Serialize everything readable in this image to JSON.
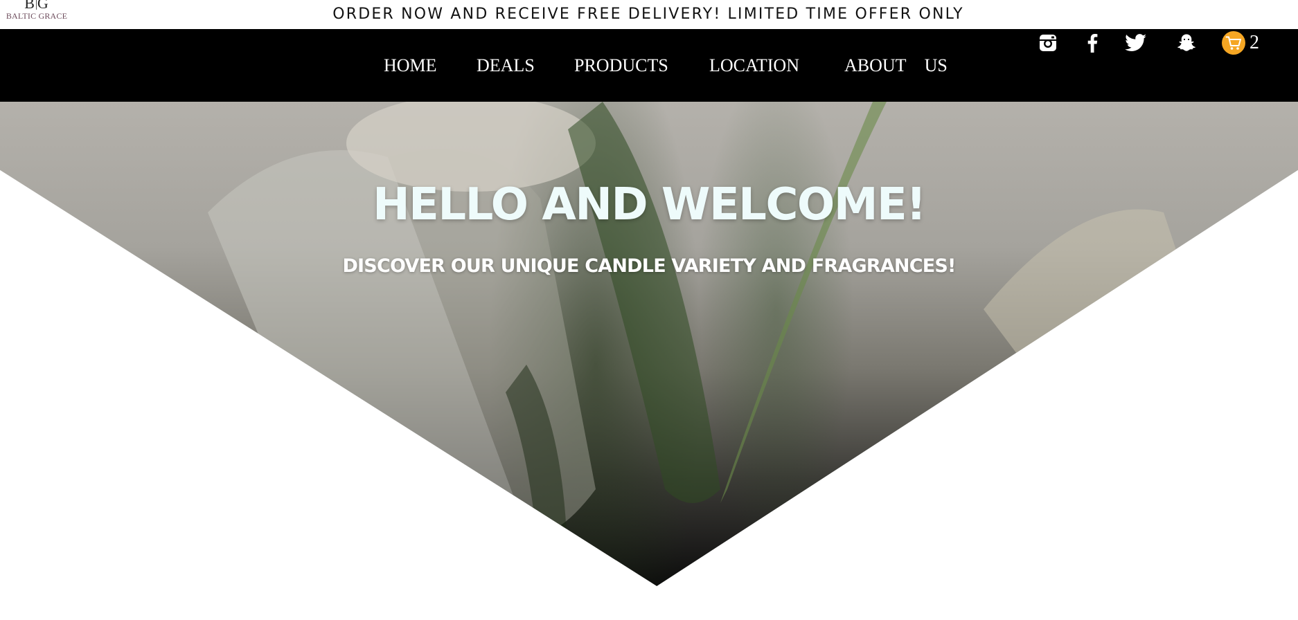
{
  "logo": {
    "mark": "B|G",
    "text": "BALTIC GRACE"
  },
  "promo": {
    "text": "ORDER NOW AND RECEIVE FREE DELIVERY! LIMITED TIME OFFER ONLY"
  },
  "nav": {
    "items": [
      {
        "label": "HOME"
      },
      {
        "label": "DEALS"
      },
      {
        "label": "PRODUCTS"
      },
      {
        "label": "LOCATION"
      },
      {
        "label": "ABOUT US"
      }
    ]
  },
  "social": {
    "icons": [
      "instagram-icon",
      "facebook-icon",
      "twitter-icon",
      "snapchat-icon"
    ]
  },
  "cart": {
    "icon": "shopping-cart-icon",
    "count": "2",
    "accent": "#f5a623"
  },
  "hero": {
    "title": "HELLO AND WELCOME!",
    "subtitle": "DISCOVER OUR UNIQUE CANDLE VARIETY AND FRAGRANCES!"
  },
  "colors": {
    "nav_background": "#000000",
    "promo_background": "#ffffff",
    "hero_text": "#eefbfb"
  }
}
